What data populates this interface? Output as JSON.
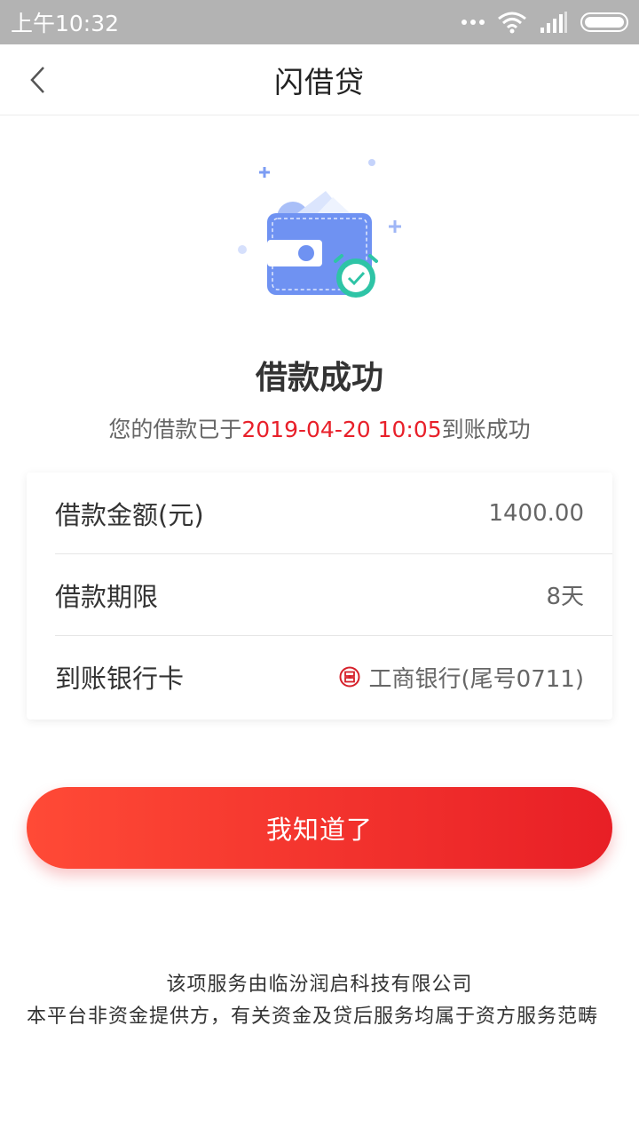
{
  "status_bar": {
    "time": "上午10:32",
    "icons": [
      "dots-icon",
      "wifi-icon",
      "signal-icon",
      "battery-icon"
    ]
  },
  "nav": {
    "title": "闪借贷",
    "back_icon": "chevron-left-icon"
  },
  "result": {
    "title": "借款成功",
    "desc_prefix": "您的借款已于",
    "desc_datetime": "2019-04-20 10:05",
    "desc_suffix": "到账成功",
    "highlight_color": "#e8202a",
    "illustration_icon": "wallet-clock-icon"
  },
  "details": {
    "rows": [
      {
        "label": "借款金额(元)",
        "value": "1400.00"
      },
      {
        "label": "借款期限",
        "value": "8天"
      },
      {
        "label": "到账银行卡",
        "value": "工商银行(尾号0711)",
        "icon": "icbc-bank-icon"
      }
    ]
  },
  "confirm_button": {
    "label": "我知道了",
    "gradient_start": "#ff4a36",
    "gradient_end": "#e81f26"
  },
  "footer": {
    "line1": "该项服务由临汾润启科技有限公司",
    "line2": "本平台非资金提供方，有关资金及贷后服务均属于资方服务范畴"
  }
}
